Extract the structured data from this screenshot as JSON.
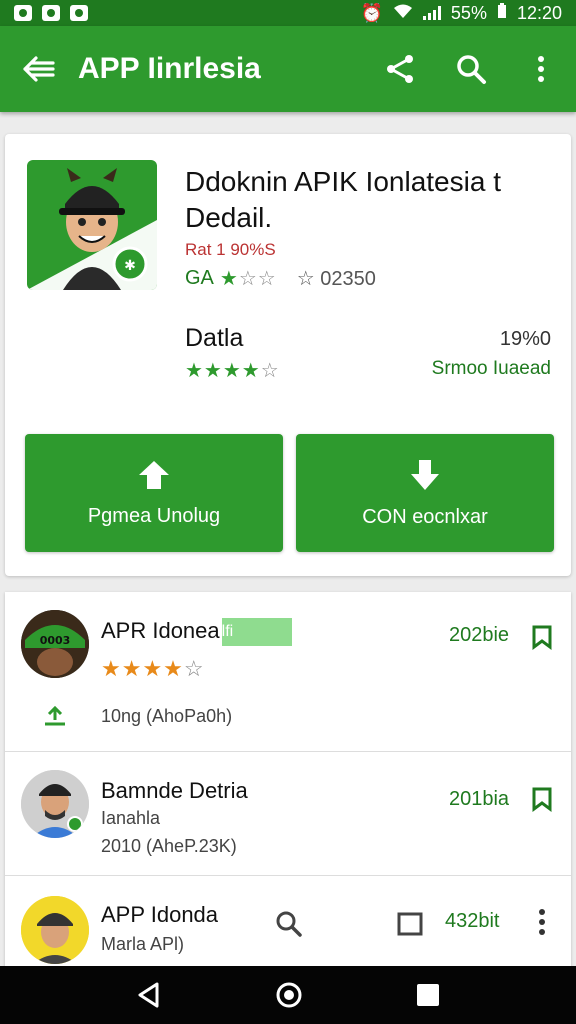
{
  "status_bar": {
    "battery": "55%",
    "time": "12:20"
  },
  "app_bar": {
    "title": "APP Iinrlesia",
    "back_icon": "arrow-left-icon",
    "share_icon": "share-icon",
    "search_icon": "search-icon",
    "more_icon": "more-vert-icon"
  },
  "detail": {
    "name": "Ddoknin APIK Ionlatesia t Dedail.",
    "meta": "Rat 1 90%S",
    "rating_prefix": "GA",
    "rating_stars": 1,
    "rating_count": "02350",
    "data_label": "Datla",
    "data_value": "19%0",
    "data_stars": 4,
    "download_size": "Srmoo Iuaead",
    "btn_left_label": "Pgmea Unolug",
    "btn_right_label": "CON eocnlxar"
  },
  "list": [
    {
      "title": "APR Idonea",
      "title_suffix": "lfi",
      "stars": 4,
      "sub": "10ng (AhoPa0h)",
      "size": "202bie"
    },
    {
      "title": "Bamnde Detria",
      "sub1": "Ianahla",
      "sub2": "2010 (AheP.23K)",
      "size": "201bia"
    },
    {
      "title": "APP Idonda",
      "sub": "Marla APl)",
      "size": "432bit"
    }
  ],
  "colors": {
    "primary": "#2e9a2e",
    "primary_dark": "#1f7a1f",
    "accent_orange": "#e88a1a"
  }
}
